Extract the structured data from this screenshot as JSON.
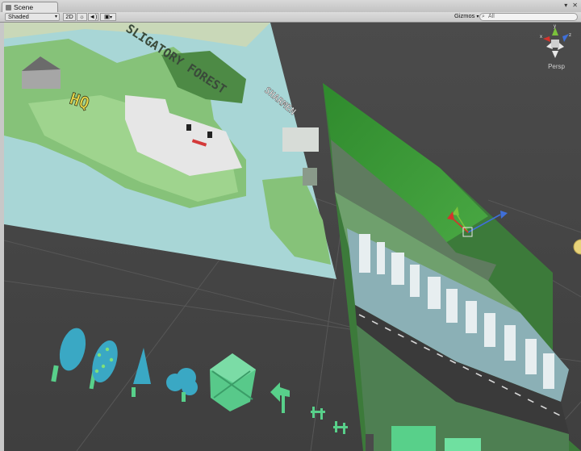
{
  "tab": {
    "title": "Scene",
    "icon": "scene-icon"
  },
  "window_buttons": {
    "menu": "▾",
    "close": "✕"
  },
  "toolbar": {
    "shading_mode": "Shaded",
    "toggle_2d": "2D",
    "lighting_icon": "sun-icon",
    "audio_icon": "speaker-icon",
    "effects_icon": "image-icon",
    "gizmos_label": "Gizmos",
    "search_placeholder": "All"
  },
  "orientation_gizmo": {
    "projection_label": "Persp",
    "axes": [
      "x",
      "y",
      "z"
    ],
    "colors": {
      "x": "#d4332c",
      "y": "#7bc23b",
      "z": "#3f6fd8"
    }
  },
  "scene": {
    "map_labels": [
      "HQ",
      "SLIGATORY FOREST",
      "SHARMEN"
    ],
    "colors": {
      "background": "#454545",
      "grid": "#5a5a5a",
      "map_water": "#a8d6d6",
      "map_land": "#86c279",
      "forest": "#3f9a3a",
      "road": "#3c3c3c",
      "building": "#7fa8b0",
      "sprite_teal": "#3aa8c4",
      "sprite_green": "#58d08a"
    }
  }
}
